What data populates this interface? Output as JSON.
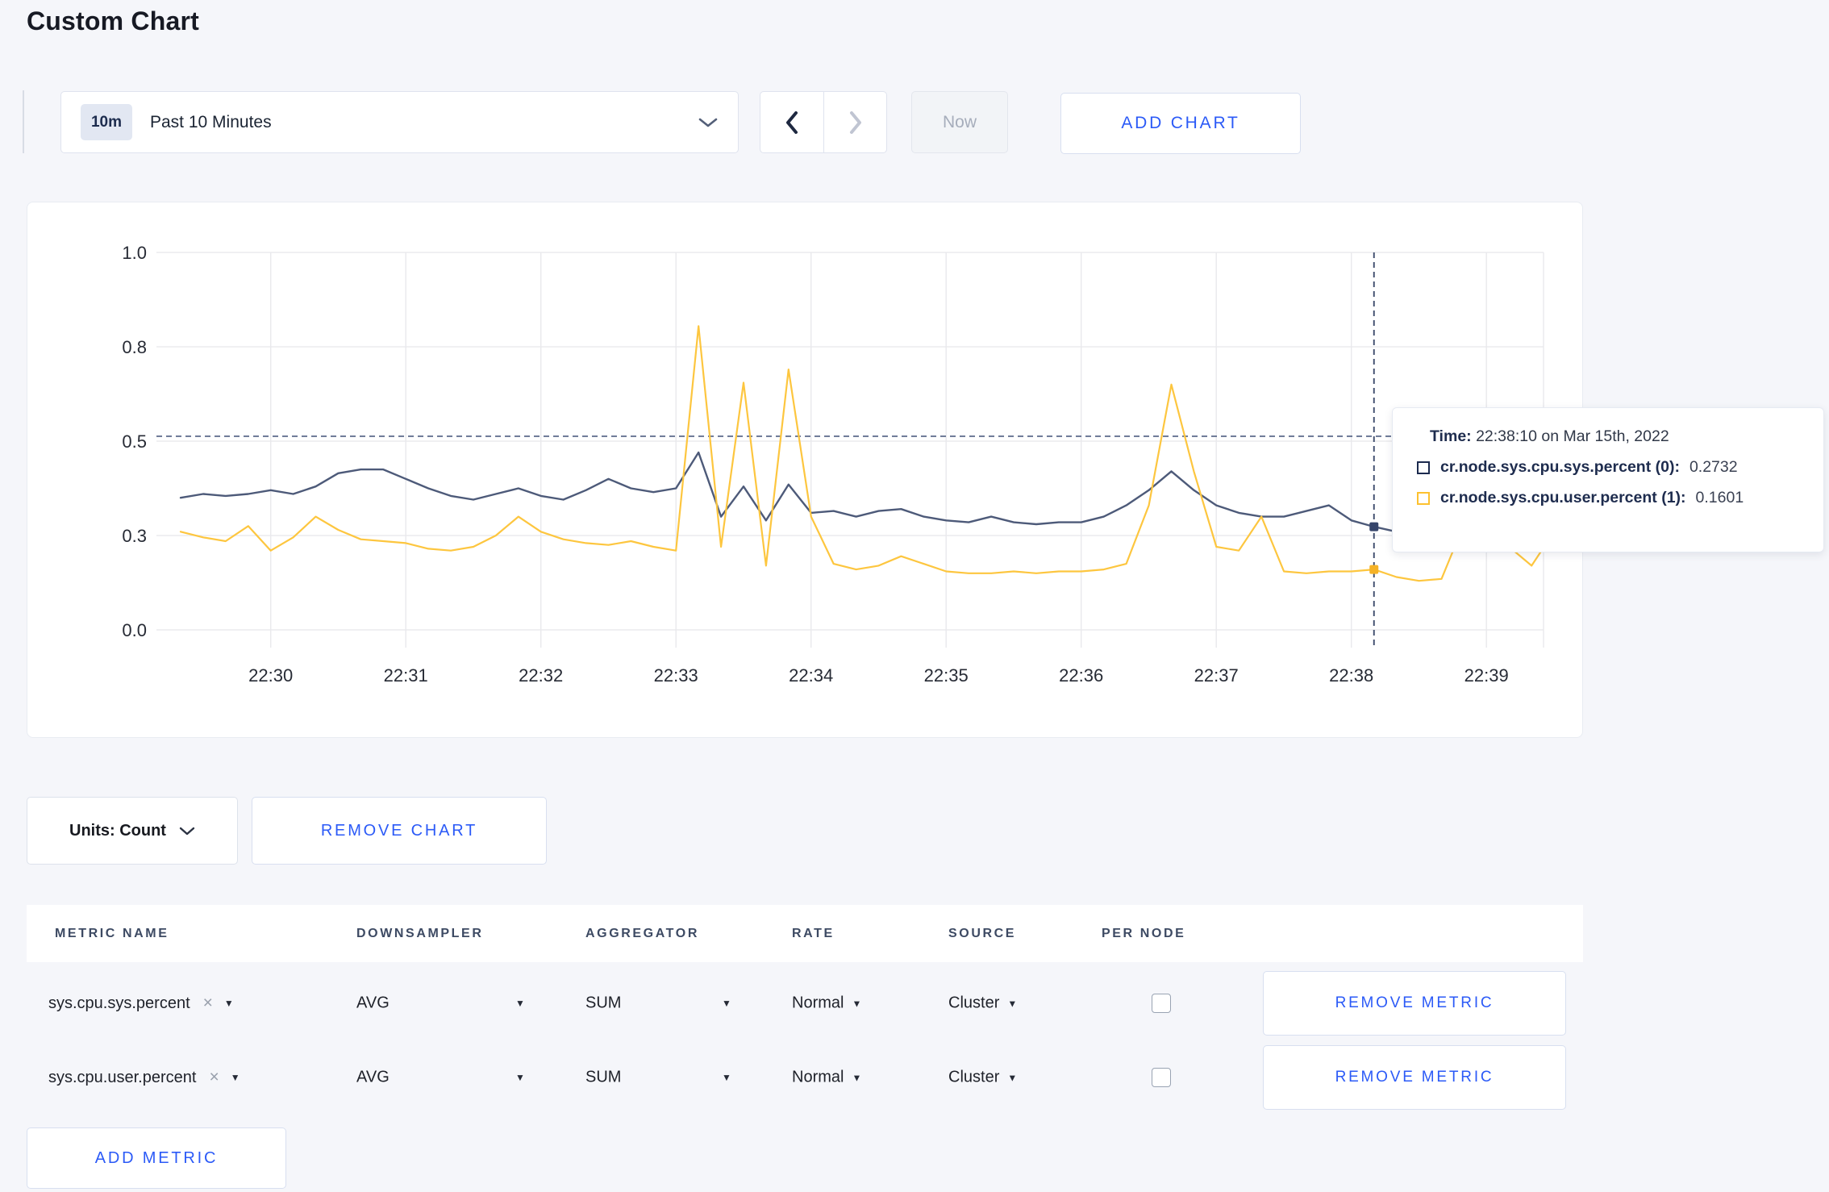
{
  "page": {
    "title": "Custom Chart",
    "background": "#f5f6fa",
    "accent_blue": "#2b5af7"
  },
  "toolbar": {
    "time_window_badge": "10m",
    "time_window_label": "Past 10 Minutes",
    "now_label": "Now",
    "add_chart_label": "ADD CHART"
  },
  "chart_data": {
    "type": "line",
    "title": "",
    "xlabel": "",
    "ylabel": "",
    "ylim": [
      0,
      1
    ],
    "grid": true,
    "legend_position": "tooltip",
    "x_tick_labels": [
      "22:30",
      "22:31",
      "22:32",
      "22:33",
      "22:34",
      "22:35",
      "22:36",
      "22:37",
      "22:38",
      "22:39"
    ],
    "y_ticks": [
      {
        "value": 0,
        "label": "0.0"
      },
      {
        "value": 0.25,
        "label": "0.3"
      },
      {
        "value": 0.5,
        "label": "0.5"
      },
      {
        "value": 0.75,
        "label": "0.8"
      },
      {
        "value": 1,
        "label": "1.0"
      }
    ],
    "start_time": "22:29:20",
    "interval_seconds": 10,
    "series": [
      {
        "name": "cr.node.sys.cpu.sys.percent",
        "color": "#4d5a79",
        "dot_color": "#36456b",
        "values": [
          0.35,
          0.36,
          0.355,
          0.36,
          0.37,
          0.36,
          0.38,
          0.415,
          0.425,
          0.425,
          0.4,
          0.375,
          0.355,
          0.345,
          0.36,
          0.375,
          0.355,
          0.345,
          0.37,
          0.4,
          0.375,
          0.365,
          0.375,
          0.47,
          0.3,
          0.38,
          0.29,
          0.385,
          0.31,
          0.315,
          0.3,
          0.315,
          0.32,
          0.3,
          0.29,
          0.285,
          0.3,
          0.285,
          0.28,
          0.285,
          0.285,
          0.3,
          0.33,
          0.37,
          0.42,
          0.37,
          0.33,
          0.31,
          0.3,
          0.3,
          0.315,
          0.33,
          0.29,
          0.2732,
          0.26,
          0.28,
          0.29,
          0.3,
          0.295,
          0.3,
          0.3,
          0.3
        ]
      },
      {
        "name": "cr.node.sys.cpu.user.percent",
        "color": "#fdc63f",
        "dot_color": "#f5b226",
        "values": [
          0.26,
          0.245,
          0.235,
          0.275,
          0.21,
          0.245,
          0.3,
          0.265,
          0.24,
          0.235,
          0.23,
          0.215,
          0.21,
          0.22,
          0.25,
          0.3,
          0.26,
          0.24,
          0.23,
          0.225,
          0.235,
          0.22,
          0.21,
          0.805,
          0.22,
          0.655,
          0.17,
          0.69,
          0.3,
          0.175,
          0.16,
          0.17,
          0.195,
          0.175,
          0.155,
          0.15,
          0.15,
          0.155,
          0.15,
          0.155,
          0.155,
          0.16,
          0.175,
          0.33,
          0.65,
          0.42,
          0.22,
          0.21,
          0.3,
          0.155,
          0.15,
          0.155,
          0.155,
          0.1601,
          0.14,
          0.13,
          0.135,
          0.28,
          0.31,
          0.22,
          0.17,
          0.26
        ]
      }
    ],
    "crosshair": {
      "time_index": 53,
      "time_label": "22:38:10",
      "hline_value": 0.513,
      "points": [
        {
          "series": 0,
          "value": 0.2732
        },
        {
          "series": 1,
          "value": 0.1601
        }
      ]
    }
  },
  "tooltip": {
    "time_label": "Time:",
    "time_value": "22:38:10 on Mar 15th, 2022",
    "rows": [
      {
        "name": "cr.node.sys.cpu.sys.percent (0):",
        "value": "0.2732",
        "color": "#1b2a4e"
      },
      {
        "name": "cr.node.sys.cpu.user.percent (1):",
        "value": "0.1601",
        "color": "#fdc12f"
      }
    ]
  },
  "chart_controls": {
    "units_label": "Units: Count",
    "remove_chart_label": "REMOVE CHART"
  },
  "metrics_table": {
    "headers": [
      "METRIC NAME",
      "DOWNSAMPLER",
      "AGGREGATOR",
      "RATE",
      "SOURCE",
      "PER NODE"
    ],
    "rows": [
      {
        "metric_name": "sys.cpu.sys.percent",
        "downsampler": "AVG",
        "aggregator": "SUM",
        "rate": "Normal",
        "source": "Cluster",
        "per_node_checked": false,
        "remove_label": "REMOVE METRIC"
      },
      {
        "metric_name": "sys.cpu.user.percent",
        "downsampler": "AVG",
        "aggregator": "SUM",
        "rate": "Normal",
        "source": "Cluster",
        "per_node_checked": false,
        "remove_label": "REMOVE METRIC"
      }
    ],
    "add_metric_label": "ADD METRIC"
  }
}
